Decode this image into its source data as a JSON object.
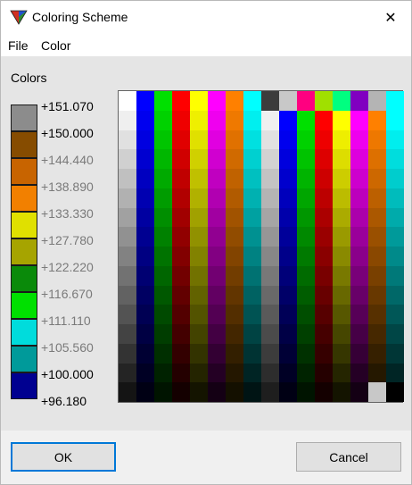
{
  "window": {
    "title": "Coloring Scheme",
    "close_glyph": "✕",
    "icon": "coloring-scheme-app-icon"
  },
  "menu": {
    "items": [
      {
        "label": "File"
      },
      {
        "label": "Color"
      }
    ]
  },
  "colors_panel": {
    "label": "Colors",
    "legend": [
      {
        "value": "+151.070",
        "color": "#8c8c8c",
        "text_color": "#000000"
      },
      {
        "value": "+150.000",
        "color": "#864c00",
        "text_color": "#000000"
      },
      {
        "value": "+144.440",
        "color": "#c86400",
        "text_color": "#7a7a7a"
      },
      {
        "value": "+138.890",
        "color": "#f28000",
        "text_color": "#7a7a7a"
      },
      {
        "value": "+133.330",
        "color": "#e0e000",
        "text_color": "#7a7a7a"
      },
      {
        "value": "+127.780",
        "color": "#a6a400",
        "text_color": "#7a7a7a"
      },
      {
        "value": "+122.220",
        "color": "#0a8a0a",
        "text_color": "#7a7a7a"
      },
      {
        "value": "+116.670",
        "color": "#00e000",
        "text_color": "#7a7a7a"
      },
      {
        "value": "+111.110",
        "color": "#00dcdc",
        "text_color": "#7a7a7a"
      },
      {
        "value": "+105.560",
        "color": "#009a9a",
        "text_color": "#7a7a7a"
      },
      {
        "value": "+100.000",
        "color": "#000090",
        "text_color": "#000000"
      },
      {
        "value": "+96.180",
        "color": "",
        "text_color": "#000000"
      }
    ],
    "palette_columns": [
      {
        "top": "#ffffff",
        "bottom": "#141414",
        "special_bottom": null
      },
      {
        "top": "#0000ff",
        "bottom": "#000014",
        "special_bottom": null
      },
      {
        "top": "#00e000",
        "bottom": "#001400",
        "special_bottom": null
      },
      {
        "top": "#ff0000",
        "bottom": "#140000",
        "special_bottom": null
      },
      {
        "top": "#ffff00",
        "bottom": "#141400",
        "special_bottom": null
      },
      {
        "top": "#ff00ff",
        "bottom": "#140014",
        "special_bottom": null
      },
      {
        "top": "#ff8000",
        "bottom": "#141000",
        "special_bottom": null
      },
      {
        "top": "#00ffff",
        "bottom": "#001414",
        "special_bottom": null
      },
      {
        "top": "#3c3c3c",
        "second": "#f0f0f0",
        "bottom": "#1e1e1e",
        "special_bottom": null
      },
      {
        "top": "#c8c8c8",
        "second": "#0000ff",
        "bottom": "#000014",
        "special_bottom": null
      },
      {
        "top": "#ff0080",
        "second": "#00e000",
        "bottom": "#001400",
        "special_bottom": null
      },
      {
        "top": "#a0e000",
        "second": "#ff0000",
        "bottom": "#140000",
        "special_bottom": null
      },
      {
        "top": "#00ff80",
        "second": "#ffff00",
        "bottom": "#141400",
        "special_bottom": null
      },
      {
        "top": "#8000c0",
        "second": "#ff00ff",
        "bottom": "#140014",
        "special_bottom": null
      },
      {
        "top": "#b4b4b4",
        "second": "#ff8000",
        "bottom": "#141000",
        "special_bottom": "#c8c8c8"
      },
      {
        "top": "#00ffff",
        "second": "#00ffff",
        "bottom": "#001414",
        "special_bottom": "#000000"
      }
    ]
  },
  "footer": {
    "ok_label": "OK",
    "cancel_label": "Cancel"
  }
}
